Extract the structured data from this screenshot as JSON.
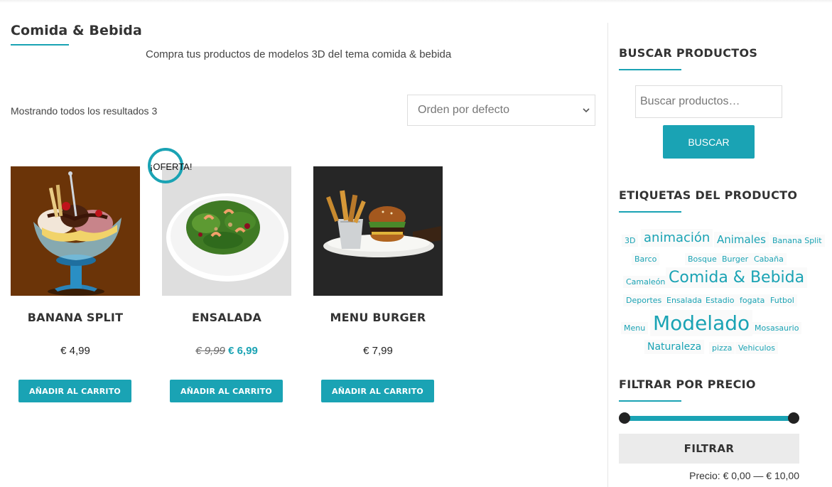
{
  "page": {
    "title": "Comida & Bebida",
    "description": "Compra tus productos de modelos 3D del tema comida & bebida",
    "result_count": "Mostrando todos los resultados 3",
    "orderby_selected": "Orden por defecto"
  },
  "products": [
    {
      "name": "BANANA SPLIT",
      "price": "€ 4,99",
      "button": "AÑADIR AL CARRITO"
    },
    {
      "name": "ENSALADA",
      "old_price": "€ 9,99",
      "price": "€ 6,99",
      "sale_badge": "¡OFERTA!",
      "button": "AÑADIR AL CARRITO"
    },
    {
      "name": "MENU BURGER",
      "price": "€ 7,99",
      "button": "AÑADIR AL CARRITO"
    }
  ],
  "sidebar": {
    "search": {
      "title": "BUSCAR PRODUCTOS",
      "placeholder": "Buscar productos…",
      "button": "BUSCAR"
    },
    "tags": {
      "title": "ETIQUETAS DEL PRODUCTO",
      "items": [
        "3D",
        "animación",
        "Animales",
        "Banana Split",
        "Barco",
        "Bosque",
        "Burger",
        "Cabaña",
        "Camaleón",
        "Comida & Bebida",
        "Deportes",
        "Ensalada",
        "Estadio",
        "fogata",
        "Futbol",
        "Menu",
        "Modelado",
        "Mosasaurio",
        "Naturaleza",
        "pizza",
        "Vehiculos"
      ]
    },
    "price_filter": {
      "title": "FILTRAR POR PRECIO",
      "min": 0,
      "max": 10,
      "button": "FILTRAR",
      "label_prefix": "Precio:",
      "range_text": "€ 0,00 — € 10,00"
    }
  },
  "colors": {
    "accent": "#1aa3b4",
    "banana_bg": "#6b3408",
    "ensalada_bg": "#dedede",
    "burger_bg": "#262626"
  },
  "icons": [
    "chevron-down-icon"
  ]
}
